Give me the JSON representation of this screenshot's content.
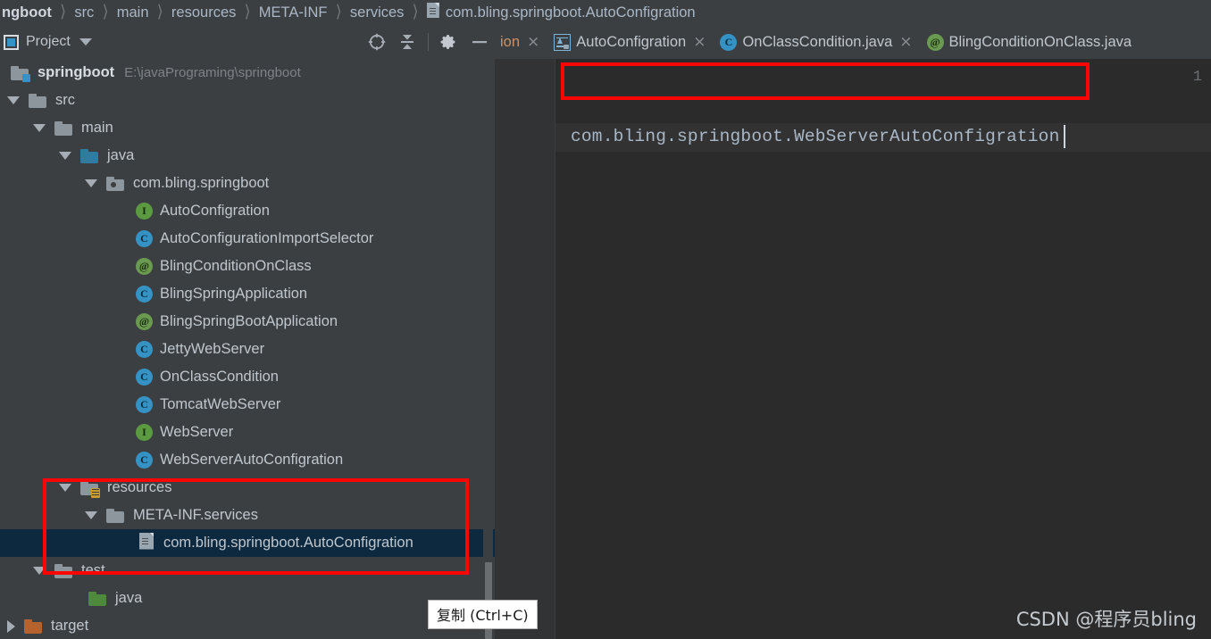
{
  "breadcrumb": {
    "name": "file-breadcrumb",
    "items": [
      {
        "label": "ngboot",
        "bold": true,
        "icon": ""
      },
      {
        "label": "src",
        "bold": false,
        "icon": ""
      },
      {
        "label": "main",
        "bold": false,
        "icon": ""
      },
      {
        "label": "resources",
        "bold": false,
        "icon": ""
      },
      {
        "label": "META-INF",
        "bold": false,
        "icon": ""
      },
      {
        "label": "services",
        "bold": false,
        "icon": ""
      },
      {
        "label": "com.bling.springboot.AutoConfigration",
        "bold": false,
        "icon": "file-icon"
      }
    ]
  },
  "project_panel": {
    "title": "Project",
    "dropdown_caret": "▼",
    "toolbar": [
      {
        "name": "locate-file-icon",
        "tooltip": "Select Opened File"
      },
      {
        "name": "collapse-all-icon",
        "tooltip": "Collapse All"
      },
      {
        "name": "settings-gear-icon",
        "tooltip": "Settings"
      },
      {
        "name": "hide-panel-icon",
        "tooltip": "Hide"
      }
    ]
  },
  "editor_tabs": [
    {
      "label": "ion",
      "icon": "none",
      "truncated": true,
      "active": false,
      "close": "×"
    },
    {
      "label": "AutoConfigration",
      "icon": "spring-autoconfig-icon",
      "truncated": false,
      "active": false,
      "close": "×"
    },
    {
      "label": "OnClassCondition.java",
      "icon": "class-icon",
      "truncated": false,
      "active": false,
      "close": "×"
    },
    {
      "label": "BlingConditionOnClass.java",
      "icon": "annotation-icon",
      "truncated": false,
      "active": true,
      "close": ""
    }
  ],
  "tree": [
    {
      "level": 0,
      "twisty": "down",
      "icon": "module-folder",
      "label": "springboot",
      "bold": true,
      "path": "E:\\javaPrograming\\springboot",
      "selected": false
    },
    {
      "level": 1,
      "twisty": "down",
      "icon": "folder-gray",
      "label": "src",
      "bold": false,
      "path": "",
      "selected": false
    },
    {
      "level": 2,
      "twisty": "down",
      "icon": "folder-gray",
      "label": "main",
      "bold": false,
      "path": "",
      "selected": false
    },
    {
      "level": 3,
      "twisty": "down",
      "icon": "folder-sources-blue",
      "label": "java",
      "bold": false,
      "path": "",
      "selected": false
    },
    {
      "level": 4,
      "twisty": "down",
      "icon": "package-folder",
      "label": "com.bling.springboot",
      "bold": false,
      "path": "",
      "selected": false
    },
    {
      "level": 5,
      "twisty": "none",
      "icon": "interface-icon",
      "label": "AutoConfigration",
      "bold": false,
      "path": "",
      "selected": false
    },
    {
      "level": 5,
      "twisty": "none",
      "icon": "class-icon",
      "label": "AutoConfigurationImportSelector",
      "bold": false,
      "path": "",
      "selected": false
    },
    {
      "level": 5,
      "twisty": "none",
      "icon": "annotation-icon",
      "label": "BlingConditionOnClass",
      "bold": false,
      "path": "",
      "selected": false
    },
    {
      "level": 5,
      "twisty": "none",
      "icon": "class-icon",
      "label": "BlingSpringApplication",
      "bold": false,
      "path": "",
      "selected": false
    },
    {
      "level": 5,
      "twisty": "none",
      "icon": "annotation-icon",
      "label": "BlingSpringBootApplication",
      "bold": false,
      "path": "",
      "selected": false
    },
    {
      "level": 5,
      "twisty": "none",
      "icon": "class-icon",
      "label": "JettyWebServer",
      "bold": false,
      "path": "",
      "selected": false
    },
    {
      "level": 5,
      "twisty": "none",
      "icon": "class-icon",
      "label": "OnClassCondition",
      "bold": false,
      "path": "",
      "selected": false
    },
    {
      "level": 5,
      "twisty": "none",
      "icon": "class-icon",
      "label": "TomcatWebServer",
      "bold": false,
      "path": "",
      "selected": false
    },
    {
      "level": 5,
      "twisty": "none",
      "icon": "interface-icon",
      "label": "WebServer",
      "bold": false,
      "path": "",
      "selected": false
    },
    {
      "level": 5,
      "twisty": "none",
      "icon": "class-icon",
      "label": "WebServerAutoConfigration",
      "bold": false,
      "path": "",
      "selected": false
    },
    {
      "level": 3,
      "twisty": "down",
      "icon": "folder-resources",
      "label": "resources",
      "bold": false,
      "path": "",
      "selected": false
    },
    {
      "level": 4,
      "twisty": "down",
      "icon": "folder-gray",
      "label": "META-INF.services",
      "bold": false,
      "path": "",
      "selected": false
    },
    {
      "level": 5,
      "twisty": "none",
      "icon": "file-icon",
      "label": "com.bling.springboot.AutoConfigration",
      "bold": false,
      "path": "",
      "selected": true
    },
    {
      "level": 2,
      "twisty": "down",
      "icon": "folder-gray",
      "label": "test",
      "bold": false,
      "path": "",
      "selected": false
    },
    {
      "level": 3,
      "twisty": "none",
      "icon": "folder-test-green",
      "label": "java",
      "bold": false,
      "path": "",
      "selected": false
    },
    {
      "level": 1,
      "twisty": "right",
      "icon": "folder-target-orange",
      "label": "target",
      "bold": false,
      "path": "",
      "selected": false
    }
  ],
  "editor": {
    "line_number": "1",
    "code": "com.bling.springboot.WebServerAutoConfigration",
    "caret_visible": true
  },
  "tooltip": {
    "text": "复制 (Ctrl+C)"
  },
  "watermark": {
    "text": "CSDN @程序员bling"
  },
  "colors": {
    "panel_bg": "#3c3f41",
    "editor_bg": "#2b2b2b",
    "gutter_bg": "#313335",
    "selection_bg": "#0d293f",
    "text": "#bfc7ce",
    "code_text": "#a9b7c6",
    "annotation_red": "#fb0505",
    "accent_blue": "#3592c4",
    "accent_green": "#5c9a41"
  }
}
